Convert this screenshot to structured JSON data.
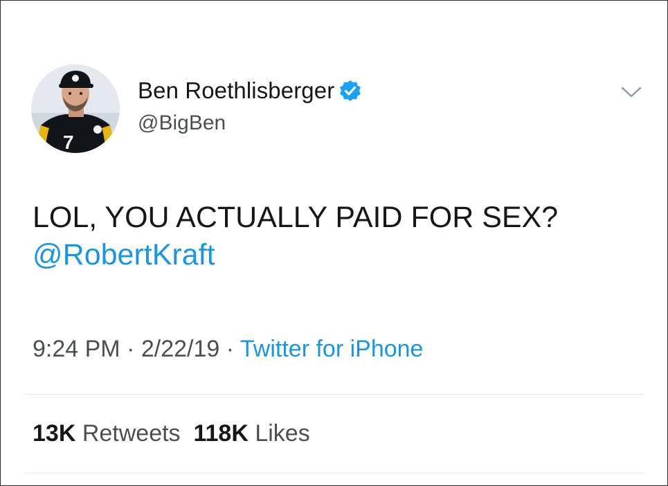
{
  "user": {
    "display_name": "Ben Roethlisberger",
    "handle": "@BigBen",
    "verified": true,
    "jersey_number": "7"
  },
  "tweet": {
    "line1": "LOL, YOU ACTUALLY PAID FOR SEX?",
    "mention": "@RobertKraft"
  },
  "meta": {
    "time": "9:24 PM",
    "sep1": " · ",
    "date": "2/22/19",
    "sep2": " · ",
    "source": "Twitter for iPhone"
  },
  "stats": {
    "retweets_count": "13K",
    "retweets_label": "Retweets",
    "likes_count": "118K",
    "likes_label": "Likes"
  },
  "colors": {
    "link": "#1b95e0",
    "text": "#14171a",
    "secondary": "#4a4f54",
    "divider": "#e1e8ed"
  },
  "icons": {
    "verified": "verified-badge-icon",
    "caret": "chevron-down-icon"
  }
}
